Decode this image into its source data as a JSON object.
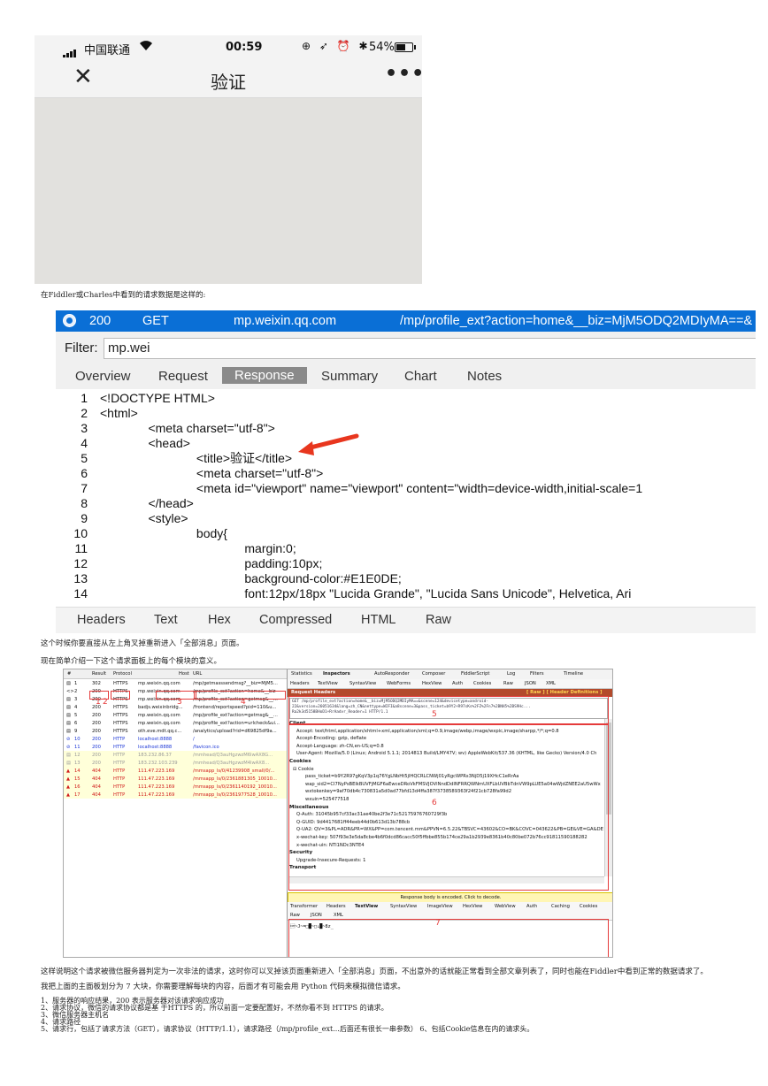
{
  "phone": {
    "carrier": "中国联通",
    "time": "00:59",
    "battery": "54%",
    "title": "验证",
    "close_glyph": "✕",
    "more_glyph": "•••",
    "status_icons": "⊕ ➶ ⏰ ✱"
  },
  "caption1": "在Fiddler或Charles中看到的请求数据是这样的:",
  "response": {
    "session": {
      "result": "200",
      "method": "GET",
      "host": "mp.weixin.qq.com",
      "url": "/mp/profile_ext?action=home&__biz=MjM5ODQ2MDIyMA==&"
    },
    "filter_label": "Filter:",
    "filter_value": "mp.wei",
    "tabs": [
      "Overview",
      "Request",
      "Response",
      "Summary",
      "Chart",
      "Notes"
    ],
    "lines": [
      {
        "n": "1",
        "t": "<!DOCTYPE HTML>"
      },
      {
        "n": "2",
        "t": "<html>"
      },
      {
        "n": "3",
        "t": "              <meta charset=\"utf-8\">"
      },
      {
        "n": "4",
        "t": "              <head>"
      },
      {
        "n": "5",
        "t": "                            <title>验证</title>"
      },
      {
        "n": "6",
        "t": "                            <meta charset=\"utf-8\">"
      },
      {
        "n": "7",
        "t": "                            <meta id=\"viewport\" name=\"viewport\" content=\"width=device-width,initial-scale=1"
      },
      {
        "n": "8",
        "t": "              </head>"
      },
      {
        "n": "9",
        "t": "              <style>"
      },
      {
        "n": "10",
        "t": "                            body{"
      },
      {
        "n": "11",
        "t": "                                          margin:0;"
      },
      {
        "n": "12",
        "t": "                                          padding:10px;"
      },
      {
        "n": "13",
        "t": "                                          background-color:#E1E0DE;"
      },
      {
        "n": "14",
        "t": "                                          font:12px/18px \"Lucida Grande\", \"Lucida Sans Unicode\", Helvetica, Ari"
      }
    ],
    "bottom_tabs": [
      "Headers",
      "Text",
      "Hex",
      "Compressed",
      "HTML",
      "Raw"
    ]
  },
  "para1": "这个时候你要直接从左上角叉掉重新进入「全部消息」页面。",
  "para2": "现在简单介绍一下这个请求面板上的每个模块的意义。",
  "fiddler": {
    "columns": [
      "#",
      "Result",
      "Protocol",
      "Host",
      "URL"
    ],
    "sessions": [
      {
        "id": "1",
        "result": "302",
        "protocol": "HTTPS",
        "host": "mp.weixin.qq.com",
        "url": "/mp/getmasssendmsg?__biz=MjM5...",
        "icon": "▤",
        "color": "#111111",
        "bg": "#ffffff"
      },
      {
        "id": "2",
        "result": "200",
        "protocol": "HTTPS",
        "host": "mp.weixin.qq.com",
        "url": "/mp/profile_ext?action=home&__biz",
        "icon": "<>",
        "color": "#111111",
        "bg": "#ffffff"
      },
      {
        "id": "3",
        "result": "200",
        "protocol": "HTTPS",
        "host": "mp.weixin.qq.com",
        "url": "/mp/profile_ext?action=getmsg&__...",
        "icon": "▤",
        "color": "#111111",
        "bg": "#ffffff"
      },
      {
        "id": "4",
        "result": "200",
        "protocol": "HTTPS",
        "host": "badjs.weixinbridg...",
        "url": "/frontend/reportspeed?pid=110&u...",
        "icon": "▤",
        "color": "#111111",
        "bg": "#ffffff"
      },
      {
        "id": "5",
        "result": "200",
        "protocol": "HTTPS",
        "host": "mp.weixin.qq.com",
        "url": "/mp/profile_ext?action=getmsg&__...",
        "icon": "▤",
        "color": "#111111",
        "bg": "#ffffff"
      },
      {
        "id": "6",
        "result": "200",
        "protocol": "HTTPS",
        "host": "mp.weixin.qq.com",
        "url": "/mp/profile_ext?action=urlcheck&ui...",
        "icon": "▤",
        "color": "#111111",
        "bg": "#ffffff"
      },
      {
        "id": "9",
        "result": "200",
        "protocol": "HTTPS",
        "host": "oth.eve.mdt.qq.c...",
        "url": "/analytics/upload?rid=d69825df9a...",
        "icon": "▤",
        "color": "#111111",
        "bg": "#ffffff"
      },
      {
        "id": "10",
        "result": "200",
        "protocol": "HTTP",
        "host": "localhost:8888",
        "url": "/",
        "icon": "⊘",
        "color": "#1a35d6",
        "bg": "#ffffff"
      },
      {
        "id": "11",
        "result": "200",
        "protocol": "HTTP",
        "host": "localhost:8888",
        "url": "/favicon.ico",
        "icon": "⊘",
        "color": "#1a35d6",
        "bg": "#ffffff"
      },
      {
        "id": "12",
        "result": "200",
        "protocol": "HTTP",
        "host": "183.232.86.37",
        "url": "/mmhead/Q3auHgzwzM6lwAX8G...",
        "icon": "▤",
        "color": "#999999",
        "bg": "#ffffd9"
      },
      {
        "id": "13",
        "result": "200",
        "protocol": "HTTP",
        "host": "183.232.103.239",
        "url": "/mmhead/Q3auHgzwzM4lwAX8...",
        "icon": "▤",
        "color": "#999999",
        "bg": "#ffffd9"
      },
      {
        "id": "14",
        "result": "404",
        "protocol": "HTTP",
        "host": "111.47.223.169",
        "url": "/mmsapp_ls/0/41239908_small/0/...",
        "icon": "▲",
        "color": "#d01818",
        "bg": "#ffffd9"
      },
      {
        "id": "15",
        "result": "404",
        "protocol": "HTTP",
        "host": "111.47.223.169",
        "url": "/mmsapp_ls/0/2361881305_10010...",
        "icon": "▲",
        "color": "#d01818",
        "bg": "#ffffd9"
      },
      {
        "id": "16",
        "result": "404",
        "protocol": "HTTP",
        "host": "111.47.223.169",
        "url": "/mmsapp_ls/0/2361140192_10010...",
        "icon": "▲",
        "color": "#d01818",
        "bg": "#ffffd9"
      },
      {
        "id": "17",
        "result": "404",
        "protocol": "HTTP",
        "host": "111.47.223.169",
        "url": "/mmsapp_ls/0/2361977528_10010...",
        "icon": "▲",
        "color": "#d01818",
        "bg": "#ffffd9"
      }
    ],
    "toolbar": [
      "Statistics",
      "Inspectors",
      "AutoResponder",
      "Composer",
      "FiddlerScript",
      "Log",
      "Filters",
      "Timeline"
    ],
    "req_tabs": [
      "Headers",
      "TextView",
      "SyntaxView",
      "WebForms",
      "HexView",
      "Auth",
      "Cookies",
      "Raw",
      "JSON",
      "XML"
    ],
    "request_headers_title": "Request Headers",
    "request_headers_links": "[ Raw ]    [ Header Definitions ]",
    "request_line_1": "GET /mp/profile_ext?action=home&__biz=MjM5ODQ2MDIyMA==&scene=124&devicetype=android-",
    "request_line_2": "22&version=26051634&lang=zh_CN&nettype=WIFI&a8scene=3&pass_ticket=b9Y2+R97sKs%2FZ%2Fn7%2BNH5%2BS9Hc...",
    "request_line_3": "Ra2k3d5158BHoD1+RrAadvr_Reader=1 HTTP/1.1",
    "headers": [
      {
        "t": "Client",
        "b": true,
        "indent": 0
      },
      {
        "t": "Accept: text/html,application/xhtml+xml,application/xml;q=0.9,image/webp,image/wxpic,image/sharpp,*/*;q=0.8",
        "b": false,
        "indent": 8
      },
      {
        "t": "Accept-Encoding: gzip, deflate",
        "b": false,
        "indent": 8
      },
      {
        "t": "Accept-Language: zh-CN,en-US;q=0.8",
        "b": false,
        "indent": 8
      },
      {
        "t": "User-Agent: Mozilla/5.0 (Linux; Android 5.1.1; 2014813 Build/LMY47V; wv) AppleWebKit/537.36 (KHTML, like Gecko) Version/4.0 Ch",
        "b": false,
        "indent": 8
      },
      {
        "t": "Cookies",
        "b": true,
        "indent": 0
      },
      {
        "t": "⊟  Cookie",
        "b": false,
        "indent": 4
      },
      {
        "t": "pass_ticket=b9Y2R97gKqV3p1q76YgLNbHt5jlHQCRLCNWj01yRgcWPRs3NjD5j19XHcC1eRrAa",
        "b": false,
        "indent": 18
      },
      {
        "t": "wap_sid2=CI7NyPsBElkBUVFjMGF6aEwceDRoVkFMSVJOVlNndDdINFRRQWNmUXFLbUVBbTdnVW9pLUE5a04wWjdZNEE2aU5wWx",
        "b": false,
        "indent": 18
      },
      {
        "t": "wxtokenkey=9af70db4c730831a5d0ad77bfd13d4ffa387f3738589363f24f21cb728fa99d2",
        "b": false,
        "indent": 18
      },
      {
        "t": "wxuin=525477518",
        "b": false,
        "indent": 18
      },
      {
        "t": "Miscellaneous",
        "b": true,
        "indent": 0
      },
      {
        "t": "Q-Auth: 31045b957cf33ac31ae40be2f3e71c52175976760729f3b",
        "b": false,
        "indent": 8
      },
      {
        "t": "Q-GUID: 9d4417681ff44eeb44d0b613d13b788cb",
        "b": false,
        "indent": 8
      },
      {
        "t": "Q-UA2: QV=3&PL=ADR&PR=WX&PP=com.tencent.mm&PPVN=6.5.22&TBSVC=43602&CO=BK&COVC=043622&PB=GE&VE=GA&DE",
        "b": false,
        "indent": 8
      },
      {
        "t": "x-wechat-key: 507f93e3e5da8cbe4b6f0dcd86cacc50f5ffbbe855b174ce29a1b2939e8361b40c80be072b76cc91811590188282",
        "b": false,
        "indent": 8
      },
      {
        "t": "x-wechat-uin: NTI1NDc3NTE4",
        "b": false,
        "indent": 8
      },
      {
        "t": "Security",
        "b": true,
        "indent": 0
      },
      {
        "t": "Upgrade-Insecure-Requests: 1",
        "b": false,
        "indent": 8
      },
      {
        "t": "Transport",
        "b": true,
        "indent": 0
      }
    ],
    "encoded_notice": "Response body is encoded. Click to decode.",
    "resp_tabs_1": [
      "Transformer",
      "Headers",
      "TextView",
      "SyntaxView",
      "ImageView",
      "HexView",
      "WebView",
      "Auth",
      "Caching",
      "Cookies"
    ],
    "resp_tabs_2": [
      "Raw",
      "JSON",
      "XML"
    ],
    "resp_body": "\u0001~J~=□█~□↓█~8z_",
    "markers": [
      "1",
      "2",
      "3",
      "4",
      "5",
      "6",
      "7"
    ]
  },
  "para3": "这样说明这个请求被微信服务器判定为一次非法的请求，这时你可以叉掉该页面重新进入「全部消息」页面，不出意外的话就能正常看到全部文章列表了，同时也能在Fiddler中看到正常的数据请求了。",
  "para4": "我把上面的主面板划分为 7 大块，你需要理解每块的内容，后面才有可能会用 Python 代码来模拟微信请求。",
  "list": [
    "1、服务器的响应结果，200 表示服务器对该请求响应成功",
    "2、请求协议，微信的请求协议都是基 于HTTPS 的，所以前面一定要配置好，不然你看不到 HTTPS 的请求。",
    "3、微信服务器主机名",
    "4、请求路径",
    "5、请求行，包括了请求方法（GET），请求协议（HTTP/1.1），请求路径（/mp/profile_ext...后面还有很长一串参数） 6、包括Cookie信息在内的请求头。"
  ]
}
